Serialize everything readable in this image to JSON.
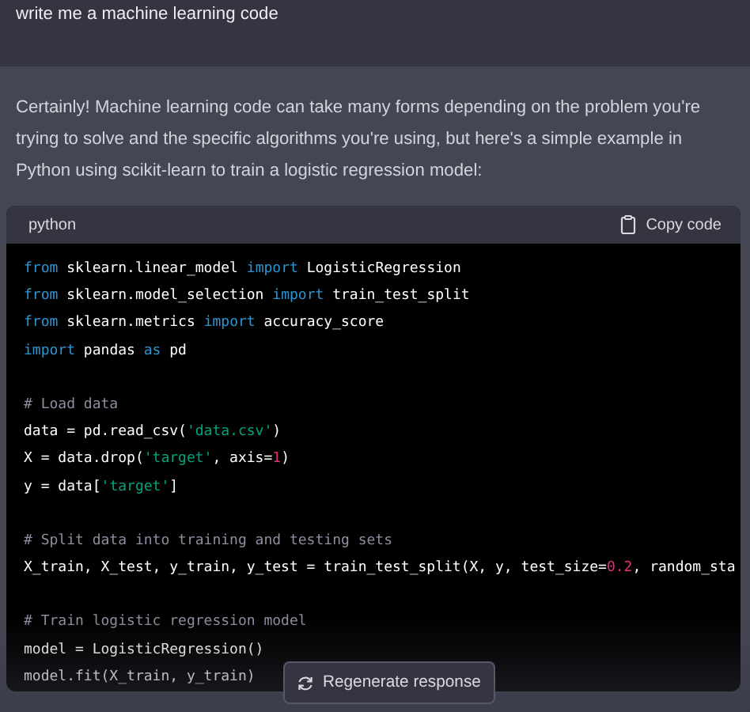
{
  "user_message": "write me a machine learning code",
  "assistant_message": "Certainly! Machine learning code can take many forms depending on the problem you're trying to solve and the specific algorithms you're using, but here's a simple example in Python using scikit-learn to train a logistic regression model:",
  "code_block": {
    "language": "python",
    "copy_label": "Copy code",
    "lines": [
      {
        "kind": "code",
        "tokens": [
          {
            "kind": "keyword",
            "text": "from"
          },
          {
            "kind": "plain",
            "text": " sklearn.linear_model "
          },
          {
            "kind": "keyword",
            "text": "import"
          },
          {
            "kind": "plain",
            "text": " LogisticRegression"
          }
        ]
      },
      {
        "kind": "code",
        "tokens": [
          {
            "kind": "keyword",
            "text": "from"
          },
          {
            "kind": "plain",
            "text": " sklearn.model_selection "
          },
          {
            "kind": "keyword",
            "text": "import"
          },
          {
            "kind": "plain",
            "text": " train_test_split"
          }
        ]
      },
      {
        "kind": "code",
        "tokens": [
          {
            "kind": "keyword",
            "text": "from"
          },
          {
            "kind": "plain",
            "text": " sklearn.metrics "
          },
          {
            "kind": "keyword",
            "text": "import"
          },
          {
            "kind": "plain",
            "text": " accuracy_score"
          }
        ]
      },
      {
        "kind": "code",
        "tokens": [
          {
            "kind": "keyword",
            "text": "import"
          },
          {
            "kind": "plain",
            "text": " pandas "
          },
          {
            "kind": "keyword",
            "text": "as"
          },
          {
            "kind": "plain",
            "text": " pd"
          }
        ]
      },
      {
        "kind": "blank"
      },
      {
        "kind": "code",
        "tokens": [
          {
            "kind": "comment",
            "text": "# Load data"
          }
        ]
      },
      {
        "kind": "code",
        "tokens": [
          {
            "kind": "plain",
            "text": "data = pd.read_csv("
          },
          {
            "kind": "string",
            "text": "'data.csv'"
          },
          {
            "kind": "plain",
            "text": ")"
          }
        ]
      },
      {
        "kind": "code",
        "tokens": [
          {
            "kind": "plain",
            "text": "X = data.drop("
          },
          {
            "kind": "string",
            "text": "'target'"
          },
          {
            "kind": "plain",
            "text": ", axis="
          },
          {
            "kind": "number",
            "text": "1"
          },
          {
            "kind": "plain",
            "text": ")"
          }
        ]
      },
      {
        "kind": "code",
        "tokens": [
          {
            "kind": "plain",
            "text": "y = data["
          },
          {
            "kind": "string",
            "text": "'target'"
          },
          {
            "kind": "plain",
            "text": "]"
          }
        ]
      },
      {
        "kind": "blank"
      },
      {
        "kind": "code",
        "tokens": [
          {
            "kind": "comment",
            "text": "# Split data into training and testing sets"
          }
        ]
      },
      {
        "kind": "code",
        "tokens": [
          {
            "kind": "plain",
            "text": "X_train, X_test, y_train, y_test = train_test_split(X, y, test_size="
          },
          {
            "kind": "number",
            "text": "0.2"
          },
          {
            "kind": "plain",
            "text": ", random_sta"
          }
        ]
      },
      {
        "kind": "blank"
      },
      {
        "kind": "code",
        "tokens": [
          {
            "kind": "comment",
            "text": "# Train logistic regression model"
          }
        ]
      },
      {
        "kind": "code",
        "tokens": [
          {
            "kind": "plain",
            "text": "model = LogisticRegression()"
          }
        ]
      },
      {
        "kind": "code",
        "tokens": [
          {
            "kind": "plain",
            "text": "model.fit(X_train, y_train)"
          }
        ]
      }
    ]
  },
  "regenerate_button": "Regenerate response"
}
